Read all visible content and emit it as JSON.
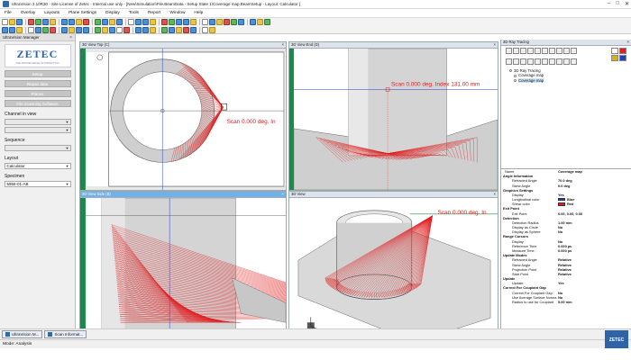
{
  "window": {
    "title": "UltraVision 3.10R30 - Site License of Zetec - Internal use only - [New\\Simulation\\File.BeamData - Setup State 1\\Coverage map.BeamSetup - Layout: Calculator ]",
    "controls": [
      "–",
      "□",
      "✕"
    ]
  },
  "menu": [
    "File",
    "Overlay",
    "Layouts",
    "Plane Settings",
    "Display",
    "Tools",
    "Report",
    "Window",
    "Help"
  ],
  "manager": {
    "title": "UltraVision Manager",
    "logo_text": "ZETEC",
    "logo_tagline": "THE PROVEN EDGE IN INSPECTION",
    "buttons": [
      "Setup",
      "Repair data",
      "Planes",
      "File Scanning Software"
    ],
    "channel_label": "Channel in view",
    "sequence_label": "Sequence",
    "layout_label": "Layout",
    "layout_value": "Calculator",
    "specimen_label": "Specimen",
    "specimen_value": "5958-01-AB"
  },
  "views": {
    "top": {
      "title": "3D View Top (C)"
    },
    "end": {
      "title": "3D View End (D)",
      "annotation": "Scan 0.000 deg. Index 131.00 mm"
    },
    "side": {
      "title": "3D View Side (B)"
    },
    "three_d": {
      "title": "3D View",
      "annotation": "Scan 0.000 deg. In"
    },
    "top_annotation": "Scan 0.000 deg. In"
  },
  "ray_tracing": {
    "title": "3D Ray Tracing",
    "tree": [
      "3D Ray Tracing",
      "Coverage map",
      "Coverage map"
    ]
  },
  "properties": [
    {
      "k": "Name",
      "v": "Coverage map",
      "t": "r"
    },
    {
      "k": "Angle Information",
      "v": "",
      "t": "s"
    },
    {
      "k": "Refracted Angle",
      "v": "70.0 deg",
      "t": "c"
    },
    {
      "k": "Skew Angle",
      "v": "0.0 deg",
      "t": "c"
    },
    {
      "k": "Graphics Settings",
      "v": "",
      "t": "s"
    },
    {
      "k": "Display",
      "v": "Yes",
      "t": "c"
    },
    {
      "k": "Longitudinal color",
      "v": "Blue",
      "t": "c",
      "color": "#1f3fd0"
    },
    {
      "k": "Shear color",
      "v": "Red",
      "t": "c",
      "color": "#e02020"
    },
    {
      "k": "Exit Point",
      "v": "",
      "t": "s"
    },
    {
      "k": "Exit Point",
      "v": "0.00, 0.00, 0.00",
      "t": "c"
    },
    {
      "k": "Detection",
      "v": "",
      "t": "s"
    },
    {
      "k": "Detection Radius",
      "v": "1.00 mm",
      "t": "c"
    },
    {
      "k": "Display as Circle",
      "v": "No",
      "t": "c"
    },
    {
      "k": "Display as Sphere",
      "v": "No",
      "t": "c"
    },
    {
      "k": "Range Cursors",
      "v": "",
      "t": "s"
    },
    {
      "k": "Display",
      "v": "No",
      "t": "c"
    },
    {
      "k": "Reference Time",
      "v": "0.000 µs",
      "t": "c"
    },
    {
      "k": "Measure Time",
      "v": "0.000 µs",
      "t": "c"
    },
    {
      "k": "Update Modes",
      "v": "",
      "t": "s"
    },
    {
      "k": "Refracted Angle",
      "v": "Relative",
      "t": "c"
    },
    {
      "k": "Skew Angle",
      "v": "Relative",
      "t": "c"
    },
    {
      "k": "Projection Point",
      "v": "Relative",
      "t": "c"
    },
    {
      "k": "Start Point",
      "v": "Relative",
      "t": "c"
    },
    {
      "k": "Update",
      "v": "",
      "t": "s"
    },
    {
      "k": "Update",
      "v": "Yes",
      "t": "c"
    },
    {
      "k": "Correct For Couplant Gap",
      "v": "",
      "t": "s"
    },
    {
      "k": "Correct For Couplant Gap",
      "v": "No",
      "t": "c"
    },
    {
      "k": "Use Average Surface Norma",
      "v": "No",
      "t": "c"
    },
    {
      "k": "Radius to use for Couplant",
      "v": "5.00 mm",
      "t": "c"
    }
  ],
  "taskbar": [
    {
      "label": "UltraVision M...",
      "name": "task-ultravision-manager"
    },
    {
      "label": "Scan Informat...",
      "name": "task-scan-information"
    }
  ],
  "status": "Mode: Analysis",
  "badge": "ZETEC",
  "colors": {
    "accent": "#2f63a8",
    "rays": "#e02020",
    "cursor": "#1f3fd0",
    "selected_header": "#6fb1e8"
  }
}
